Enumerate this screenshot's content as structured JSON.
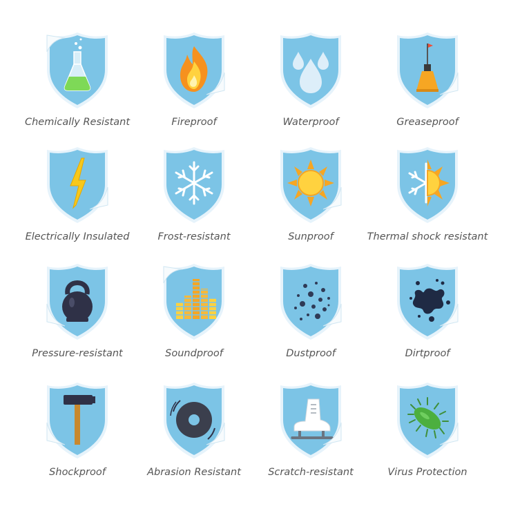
{
  "colors": {
    "shield_fill": "#7cc4e6",
    "shield_rim": "#e6f3fb",
    "label_text": "#555555"
  },
  "badges": [
    {
      "label": "Chemically Resistant",
      "icon": "flask-icon"
    },
    {
      "label": "Fireproof",
      "icon": "flame-icon"
    },
    {
      "label": "Waterproof",
      "icon": "water-drops-icon"
    },
    {
      "label": "Greaseproof",
      "icon": "oil-can-icon"
    },
    {
      "label": "Electrically Insulated",
      "icon": "lightning-icon"
    },
    {
      "label": "Frost-resistant",
      "icon": "snowflake-icon"
    },
    {
      "label": "Sunproof",
      "icon": "sun-icon"
    },
    {
      "label": "Thermal shock resistant",
      "icon": "snowflake-sun-icon"
    },
    {
      "label": "Pressure-resistant",
      "icon": "kettlebell-icon"
    },
    {
      "label": "Soundproof",
      "icon": "equalizer-icon"
    },
    {
      "label": "Dustproof",
      "icon": "dust-particles-icon"
    },
    {
      "label": "Dirtproof",
      "icon": "dirt-splat-icon"
    },
    {
      "label": "Shockproof",
      "icon": "hammer-icon"
    },
    {
      "label": "Abrasion Resistant",
      "icon": "grinding-disc-icon"
    },
    {
      "label": "Scratch-resistant",
      "icon": "ice-skate-icon"
    },
    {
      "label": "Virus Protection",
      "icon": "virus-icon"
    }
  ]
}
